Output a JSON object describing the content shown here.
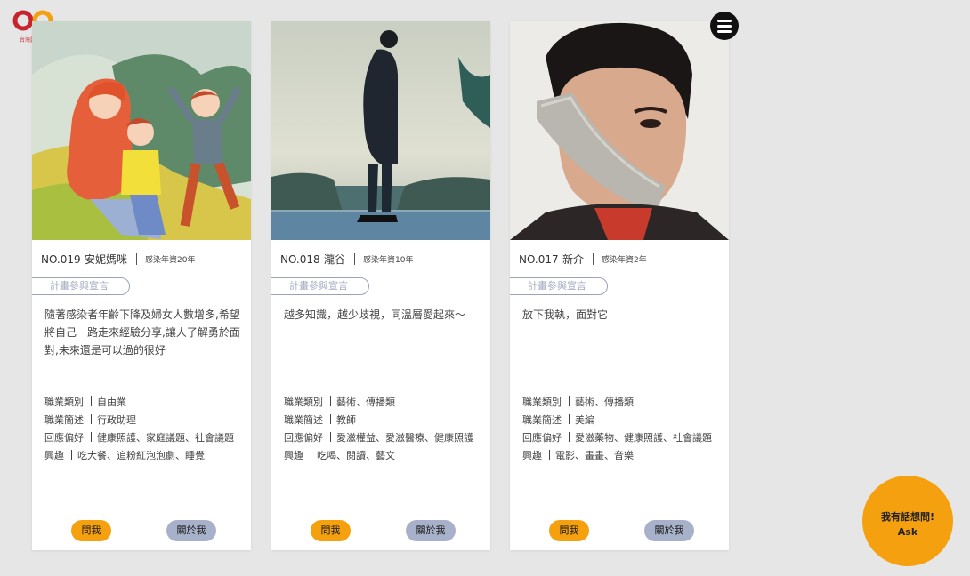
{
  "brand": {
    "logo_text": "台灣露德協會",
    "logo_color": "#c7252e",
    "logo_accent": "#f5a10f"
  },
  "menu": {
    "icon": "hamburger-menu-icon"
  },
  "cards": [
    {
      "name": "NO.019-安妮媽咪",
      "years": "感染年資20年",
      "pledge_label": "計畫參與宣言",
      "quote": "隨著感染者年齡下降及婦女人數增多,希望將自己一路走來經驗分享,讓人了解勇於面對,未來還是可以過的很好",
      "info": [
        {
          "key": "職業類別",
          "value": "自由業"
        },
        {
          "key": "職業簡述",
          "value": "行政助理"
        },
        {
          "key": "回應偏好",
          "value": "健康照護、家庭議題、社會議題"
        },
        {
          "key": "興趣",
          "value": "吃大餐、追粉紅泡泡劇、睡覺"
        }
      ],
      "ask_label": "問我",
      "about_label": "關於我",
      "image": "illustration-family-on-hill"
    },
    {
      "name": "NO.018-瀧谷",
      "years": "感染年資10年",
      "pledge_label": "計畫參與宣言",
      "quote": "越多知識，越少歧視，同溫層愛起來～",
      "info": [
        {
          "key": "職業類別",
          "value": "藝術、傳播類"
        },
        {
          "key": "職業簡述",
          "value": "教師"
        },
        {
          "key": "回應偏好",
          "value": "愛滋權益、愛滋醫療、健康照護"
        },
        {
          "key": "興趣",
          "value": "吃喝、閱讀、藝文"
        }
      ],
      "ask_label": "問我",
      "about_label": "關於我",
      "image": "photo-person-by-sea"
    },
    {
      "name": "NO.017-新介",
      "years": "感染年資2年",
      "pledge_label": "計畫參與宣言",
      "quote": "放下我執，面對它",
      "info": [
        {
          "key": "職業類別",
          "value": "藝術、傳播類"
        },
        {
          "key": "職業簡述",
          "value": "美編"
        },
        {
          "key": "回應偏好",
          "value": "愛滋藥物、健康照護、社會議題"
        },
        {
          "key": "興趣",
          "value": "電影、畫畫、音樂"
        }
      ],
      "ask_label": "問我",
      "about_label": "關於我",
      "image": "photo-man-taped-mouth"
    }
  ],
  "ask_fab": {
    "line1": "我有話想問!",
    "line2": "Ask"
  },
  "colors": {
    "accent_orange": "#f5a10f",
    "button_blue_gray": "#a7b1c9",
    "background": "#e6e6e7"
  }
}
